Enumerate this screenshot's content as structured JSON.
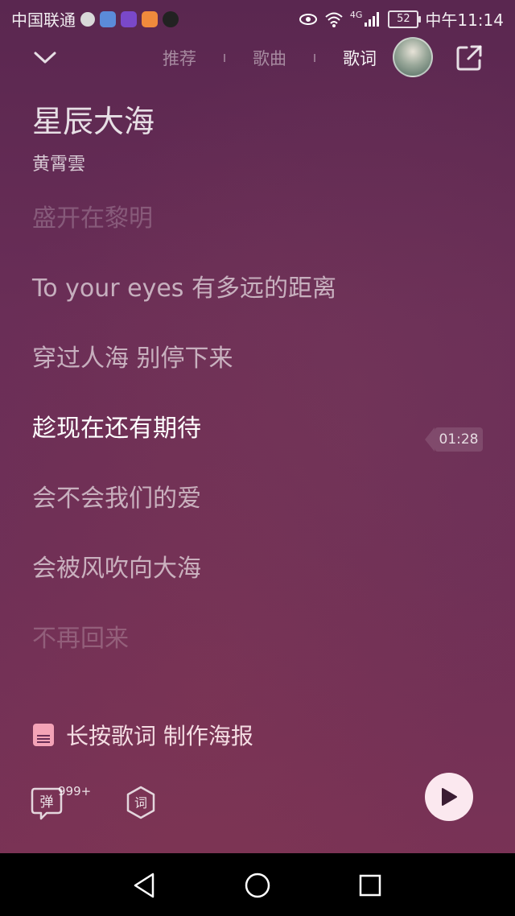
{
  "status_bar": {
    "carrier": "中国联通",
    "network": "4G",
    "battery": "52",
    "time": "中午11:14"
  },
  "header": {
    "tabs": [
      {
        "label": "推荐",
        "active": false
      },
      {
        "label": "歌曲",
        "active": false
      },
      {
        "label": "歌词",
        "active": true
      }
    ]
  },
  "song": {
    "title": "星辰大海",
    "artist": "黄霄雲"
  },
  "lyrics": [
    {
      "text": "盛开在黎明",
      "state": "dim"
    },
    {
      "text": "To your eyes 有多远的距离",
      "state": "normal"
    },
    {
      "text": "穿过人海 别停下来",
      "state": "normal"
    },
    {
      "text": "趁现在还有期待",
      "state": "current"
    },
    {
      "text": "会不会我们的爱",
      "state": "normal"
    },
    {
      "text": "会被风吹向大海",
      "state": "normal"
    },
    {
      "text": "不再回来",
      "state": "dim"
    }
  ],
  "current_time": "01:28",
  "poster": {
    "label": "长按歌词 制作海报"
  },
  "controls": {
    "danmu_label": "弹",
    "danmu_count": "999+",
    "lyric_label": "词"
  },
  "colors": {
    "background_top": "#5a2750",
    "background_bottom": "#7b3355",
    "play_button": "#fbe8ef",
    "poster_icon": "#f4a3b7"
  },
  "icons": {
    "collapse": "chevron-down-icon",
    "share": "share-icon",
    "poster": "poster-icon",
    "danmu": "danmu-icon",
    "lyric": "lyric-icon",
    "play": "play-icon",
    "nav_back": "back-icon",
    "nav_home": "home-icon",
    "nav_recent": "recent-apps-icon"
  }
}
